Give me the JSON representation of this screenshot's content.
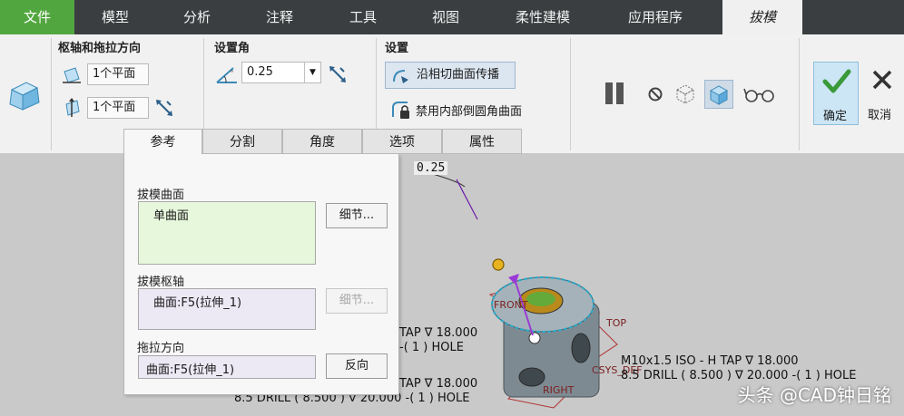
{
  "menu": {
    "tabs": [
      "文件",
      "模型",
      "分析",
      "注释",
      "工具",
      "视图",
      "柔性建模",
      "应用程序",
      "拔模"
    ]
  },
  "ribbon": {
    "pivot_group_title": "枢轴和拖拉方向",
    "pivot_value": "1个平面",
    "pull_value": "1个平面",
    "angle_group_title": "设置角",
    "angle_value": "0.25",
    "settings_group_title": "设置",
    "propagate_label": "沿相切曲面传播",
    "disable_round_label": "禁用内部倒圆角曲面",
    "ok_label": "确定",
    "cancel_label": "取消"
  },
  "subtabs": [
    "参考",
    "分割",
    "角度",
    "选项",
    "属性"
  ],
  "panel": {
    "draft_surfaces_label": "拔模曲面",
    "draft_surfaces_value": "单曲面",
    "detail_button": "细节...",
    "draft_hinge_label": "拔模枢轴",
    "draft_hinge_value": "曲面:F5(拉伸_1)",
    "detail_button_2": "细节...",
    "pull_direction_label": "拖拉方向",
    "pull_direction_value": "曲面:F5(拉伸_1)",
    "flip_button": "反向"
  },
  "graphics": {
    "angle_annotation": "0.25",
    "front_label": "FRONT",
    "top_label": "TOP",
    "csys_label": "CSYS_DEF",
    "right_label": "RIGHT",
    "tap_top_left": "TAP ∇ 18.000",
    "hole_top_left": "-( 1 ) HOLE",
    "tap_right": "M10x1.5 ISO - H TAP ∇ 18.000",
    "drill_right": "8.5 DRILL ( 8.500 ) ∇ 20.000 -( 1 ) HOLE",
    "tap_bottom": "TAP ∇ 18.000",
    "drill_bottom": "8.5 DRILL ( 8.500 ) ∇ 20.000 -( 1 ) HOLE",
    "watermark": "头条 @CAD钟日铭"
  },
  "colors": {
    "menubar": "#3a3e40",
    "file_tab": "#52a63f",
    "ok_check": "#3a9a3a",
    "part": "#8f9aa1",
    "drag_handle": "#e8b321",
    "pull_arrow": "#9b3ad6"
  }
}
